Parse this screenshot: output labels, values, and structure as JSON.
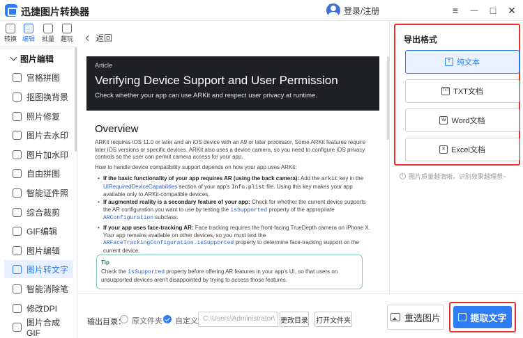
{
  "app": {
    "title": "迅捷图片转换器",
    "login": "登录/注册",
    "win_controls": {
      "menu": "≡",
      "minimize": "—",
      "maximize": "□",
      "close": "✕"
    }
  },
  "rail": [
    {
      "label": "转换",
      "icon": "convert-icon",
      "active": false
    },
    {
      "label": "编辑",
      "icon": "edit-icon",
      "active": true
    },
    {
      "label": "批量",
      "icon": "batch-icon",
      "active": false
    },
    {
      "label": "趣玩",
      "icon": "fun-icon",
      "active": false
    }
  ],
  "sidebar": {
    "header": "图片编辑",
    "items": [
      {
        "label": "宫格拼图"
      },
      {
        "label": "抠图换背景"
      },
      {
        "label": "照片修复"
      },
      {
        "label": "图片去水印"
      },
      {
        "label": "图片加水印"
      },
      {
        "label": "自由拼图"
      },
      {
        "label": "智能证件照"
      },
      {
        "label": "综合裁剪"
      },
      {
        "label": "GIF编辑"
      },
      {
        "label": "图片编辑"
      },
      {
        "label": "图片转文字",
        "active": true
      },
      {
        "label": "智能消除笔"
      },
      {
        "label": "修改DPI"
      },
      {
        "label": "图片合成GIF"
      }
    ]
  },
  "main": {
    "back": "返回",
    "doc": {
      "tag": "Article",
      "title": "Verifying Device Support and User Permission",
      "subtitle": "Check whether your app can use ARKit and respect user privacy at runtime.",
      "overview_heading": "Overview",
      "p1": "ARKit requires iOS 11.0 or later and an iOS device with an A9 or later processor. Some ARKit features require later iOS versions or specific devices. ARKit also uses a device camera, so you need to configure iOS privacy controls so the user can permit camera access for your app.",
      "p2": "How to handle device compatibility support depends on how your app uses ARKit:",
      "b1": {
        "bold": "If the basic functionality of your app requires AR (using the back camera):",
        "t1": " Add the ",
        "code1": "arkit",
        "t2": " key in the ",
        "link1": "UIRequiredDeviceCapabilities",
        "t3": " section of your app's ",
        "code2": "Info.plist",
        "t4": " file. Using this key makes your app available only to ARKit-compatible devices."
      },
      "b2": {
        "bold": "If augmented reality is a secondary feature of your app:",
        "t1": " Check for whether the current device supports the AR configuration you want to use by testing the ",
        "code1": "isSupported",
        "t2": " property of the appropriate ",
        "code2": "ARConfiguration",
        "t3": " subclass."
      },
      "b3": {
        "bold": "If your app uses face-tracking AR:",
        "t1": " Face tracking requires the front-facing TrueDepth camera on iPhone X. Your app remains available on other devices, so you must test the ",
        "code1": "ARFaceTrackingConfiguration.isSupported",
        "t2": " property to determine face-tracking support on the current device."
      },
      "tip": {
        "title": "Tip",
        "t1": "Check the ",
        "code1": "isSupported",
        "t2": " property before offering AR features in your app's UI, so that users on unsupported devices aren't disappointed by trying to access those features."
      }
    }
  },
  "bottom": {
    "output_label": "输出目录：",
    "opt_original": "原文件夹",
    "opt_custom": "自定义",
    "path": "C:\\Users\\Administrator\\",
    "change_dir": "更改目录",
    "open_folder": "打开文件夹",
    "reselect": "重选图片",
    "extract": "提取文字"
  },
  "right": {
    "title": "导出格式",
    "formats": [
      {
        "label": "纯文本",
        "icon": "T",
        "selected": true
      },
      {
        "label": "TXT文档",
        "icon": "TXT",
        "selected": false
      },
      {
        "label": "Word文档",
        "icon": "W",
        "selected": false
      },
      {
        "label": "Excel文档",
        "icon": "X",
        "selected": false
      }
    ],
    "hint": "图片质量越清晰，识别效果越理想~"
  },
  "colors": {
    "accent": "#2e7cf6",
    "highlight_border": "#e8302b",
    "hero_bg": "#1f2124",
    "tip_border": "#7ecfb0"
  }
}
